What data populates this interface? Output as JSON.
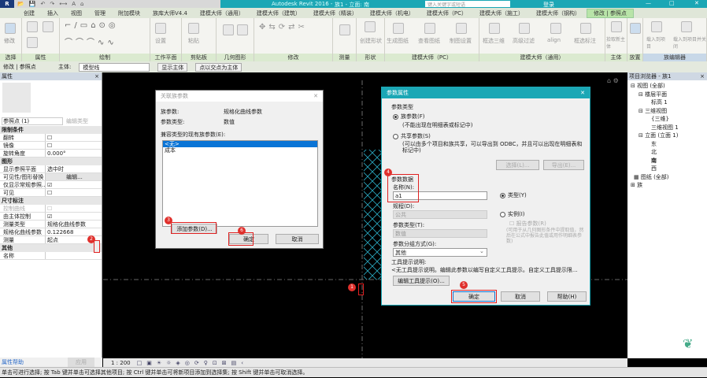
{
  "title": {
    "app": "Autodesk Revit 2016 -",
    "doc": "族1 - 立面: 南",
    "search_placeholder": "键入关键字或短语",
    "login": "登录"
  },
  "ribbon_tabs": [
    "创建",
    "插入",
    "视图",
    "管理",
    "附加模块",
    "族库大师V4.4",
    "建模大师（通用）",
    "建模大师（建筑）",
    "建模大师（精装）",
    "建模大师（机电）",
    "建模大师（PC）",
    "建模大师（施工）",
    "建模大师（钢构）",
    "修改 | 参照点"
  ],
  "ribbon_panels": [
    {
      "label": "选择",
      "items": [
        "修改"
      ]
    },
    {
      "label": "属性",
      "items": []
    },
    {
      "label": "绘制",
      "items": []
    },
    {
      "label": "工作平面",
      "items": [
        "设置"
      ]
    },
    {
      "label": "剪贴板",
      "items": [
        "粘贴"
      ]
    },
    {
      "label": "几何图形",
      "items": []
    },
    {
      "label": "修改",
      "items": []
    },
    {
      "label": "测量",
      "items": []
    },
    {
      "label": "形状",
      "items": [
        "创建形状"
      ]
    },
    {
      "label": "建模大师（PC）",
      "items": [
        "生成图纸",
        "查看图纸",
        "制图设置"
      ]
    },
    {
      "label": "建模大师（通用）",
      "items": [
        "框选三维",
        "高级过滤",
        "align",
        "框选标注"
      ]
    },
    {
      "label": "主体",
      "items": [
        "拾取新主体"
      ]
    },
    {
      "label": "放置",
      "items": []
    },
    {
      "label": "族编辑器",
      "items": [
        "载入到项目",
        "载入到项目并关闭"
      ]
    }
  ],
  "options_bar": {
    "context": "修改 | 参照点",
    "host_label": "主体:",
    "host_value": "模型线",
    "show_host": "显示主体",
    "intersect_host": "点以交点为主体"
  },
  "properties": {
    "title": "属性",
    "type_selector": "参照点 (1)",
    "edit_type": "编辑类型",
    "groups": [
      {
        "name": "限制条件",
        "rows": [
          {
            "k": "翻转",
            "v": "☐"
          },
          {
            "k": "镜像",
            "v": "☐"
          },
          {
            "k": "旋转角度",
            "v": "0.000°"
          }
        ]
      },
      {
        "name": "图形",
        "rows": [
          {
            "k": "显示参照平面",
            "v": "选中时"
          },
          {
            "k": "可见性/图形替换",
            "v": "编辑..."
          },
          {
            "k": "仅显示常规参照...",
            "v": "☑"
          },
          {
            "k": "可见",
            "v": "☐"
          }
        ]
      },
      {
        "name": "尺寸标注",
        "rows": [
          {
            "k": "控制曲线",
            "v": "☐"
          },
          {
            "k": "由主体控制",
            "v": "☑"
          },
          {
            "k": "测量类型",
            "v": "规格化曲线参数"
          },
          {
            "k": "规格化曲线参数",
            "v": "0.122668"
          },
          {
            "k": "测量",
            "v": "起点"
          }
        ]
      },
      {
        "name": "其他",
        "rows": [
          {
            "k": "名称",
            "v": ""
          }
        ]
      }
    ],
    "help": "属性帮助",
    "apply": "应用"
  },
  "browser": {
    "title": "项目浏览器 - 族1",
    "items": [
      "视图 (全部)",
      "楼层平面",
      "标高 1",
      "三维视图",
      "{三维}",
      "三维视图 1",
      "立面 (立面 1)",
      "东",
      "北",
      "南",
      "西",
      "图纸 (全部)",
      "族"
    ]
  },
  "view_bar": {
    "scale": "1 : 200"
  },
  "status": "单击可进行选择; 按 Tab 键并单击可选择其他项目; 按 Ctrl 键并单击可将新项目添加到选择集; 按 Shift 键并单击可取消选择。",
  "dialog_assoc": {
    "title": "关联族参数",
    "family_param_label": "族参数:",
    "family_param_value": "规格化曲线参数",
    "param_type_label": "参数类型:",
    "param_type_value": "数值",
    "list_label": "兼容类型的现有族参数(E):",
    "list": [
      "<无>",
      "成本"
    ],
    "add_param": "添加参数(D)...",
    "ok": "确定",
    "cancel": "取消"
  },
  "dialog_param": {
    "title": "参数属性",
    "param_type_group": "参数类型",
    "family_param": "族参数(F)",
    "family_param_note": "(不能出现在明细表或标记中)",
    "shared_param": "共享参数(S)",
    "shared_param_note": "(可以由多个项目和族共享，可以导出到 ODBC，并且可以出现在明细表和标记中)",
    "select": "选择(L)...",
    "export": "导出(E)...",
    "param_data": "参数数据",
    "name_label": "名称(N):",
    "name_value": "a1",
    "discipline_label": "规程(D):",
    "discipline_value": "公共",
    "ptype_label": "参数类型(T):",
    "ptype_value": "数值",
    "group_label": "参数分组方式(G):",
    "group_value": "其他",
    "type_radio": "类型(Y)",
    "instance_radio": "实例(I)",
    "report_param": "报告参数(R)",
    "report_note": "(可用于从几何图形条件中提取值，然后在公式中报告此值或用作明细表参数)",
    "tooltip_label": "工具提示说明:",
    "tooltip_value": "<无工具提示说明。编辑此参数以编写自定义工具提示。自定义工具提示限...",
    "edit_tooltip": "编辑工具提示(O)...",
    "ok": "确定",
    "cancel": "取消",
    "help": "帮助(H)"
  },
  "markers": [
    "1",
    "2",
    "3",
    "4",
    "5",
    "6"
  ],
  "colors": {
    "accent": "#1ba7b5",
    "marker": "#e0302c"
  }
}
